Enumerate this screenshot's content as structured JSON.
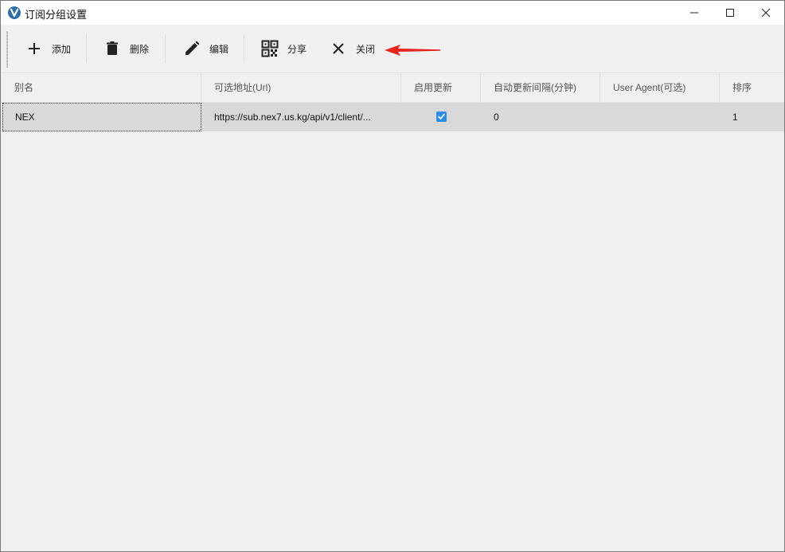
{
  "window": {
    "title": "订阅分组设置"
  },
  "toolbar": {
    "add_label": "添加",
    "delete_label": "删除",
    "edit_label": "编辑",
    "share_label": "分享",
    "close_label": "关闭"
  },
  "grid": {
    "columns": [
      "别名",
      "可选地址(Url)",
      "启用更新",
      "自动更新间隔(分钟)",
      "User Agent(可选)",
      "排序"
    ],
    "rows": [
      {
        "alias": "NEX",
        "url": "https://sub.nex7.us.kg/api/v1/client/...",
        "enabled": true,
        "interval": "0",
        "user_agent": "",
        "sort": "1"
      }
    ]
  },
  "colors": {
    "accent": "#2a8de6",
    "annotation": "#e8231c",
    "row_selected": "#d9d9d9"
  }
}
